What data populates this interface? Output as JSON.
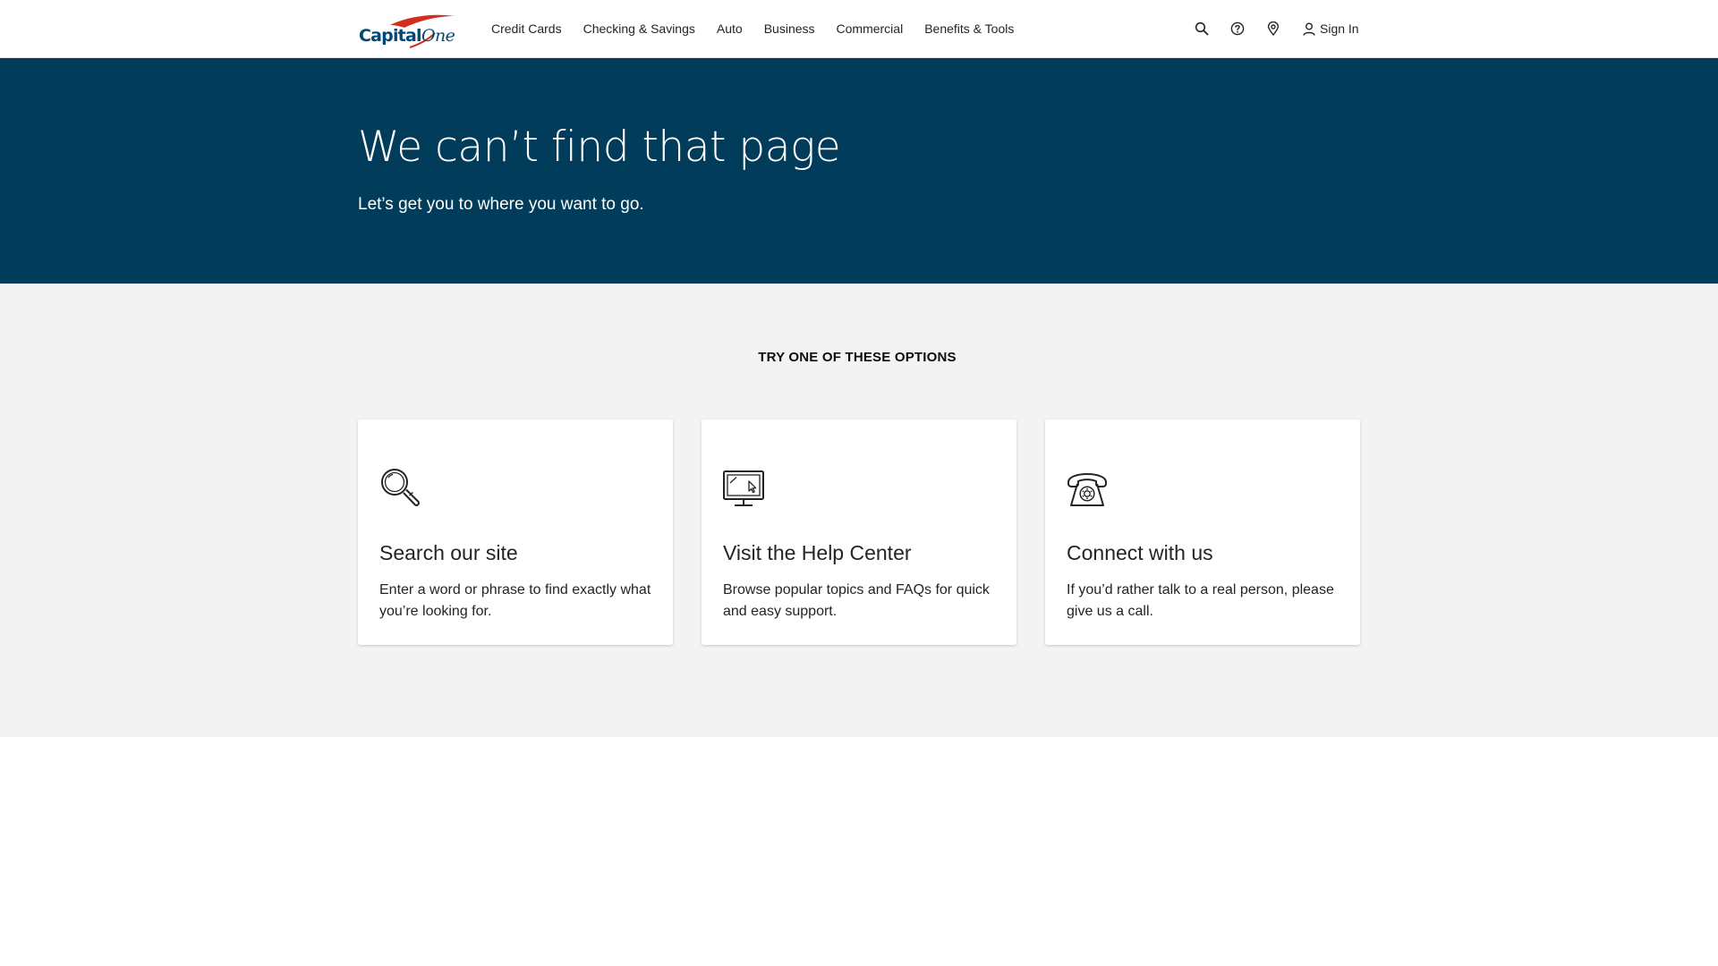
{
  "brand": {
    "logo_text": "Capital One"
  },
  "nav": {
    "items": [
      {
        "label": "Credit Cards"
      },
      {
        "label": "Checking & Savings"
      },
      {
        "label": "Auto"
      },
      {
        "label": "Business"
      },
      {
        "label": "Commercial"
      },
      {
        "label": "Benefits & Tools"
      }
    ],
    "icons": [
      "search-icon",
      "help-icon",
      "location-icon",
      "user-icon"
    ],
    "sign_in_label": "Sign In"
  },
  "hero": {
    "title": "We can’t find that page",
    "subtitle": "Let’s get you to where you want to go."
  },
  "options": {
    "heading": "TRY ONE OF THESE OPTIONS",
    "cards": [
      {
        "icon": "magnifier-icon",
        "title": "Search our site",
        "text": "Enter a word or phrase to find exactly what you’re looking for."
      },
      {
        "icon": "computer-monitor-icon",
        "title": "Visit the Help Center",
        "text": "Browse popular topics and FAQs for quick and easy support."
      },
      {
        "icon": "telephone-icon",
        "title": "Connect with us",
        "text": "If you’d rather talk to a real person, please give us a call."
      }
    ]
  },
  "colors": {
    "hero_background": "#013d5b",
    "options_background": "#f3f3f3",
    "logo_swoosh": "#d22e1e",
    "logo_text": "#004977"
  }
}
